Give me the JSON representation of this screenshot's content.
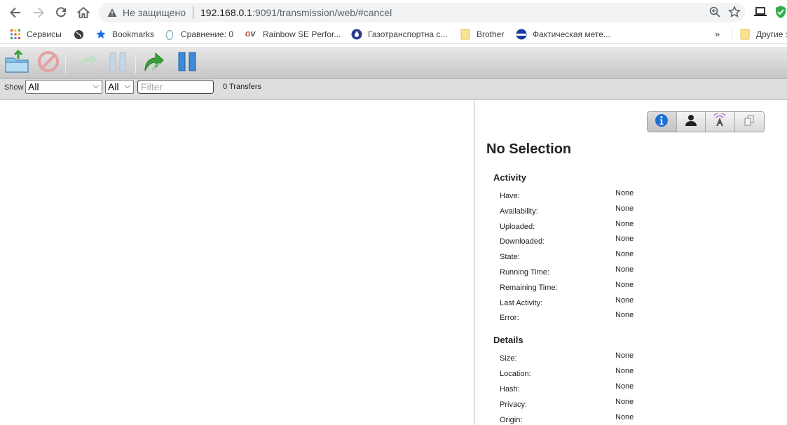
{
  "browser": {
    "omnibox": {
      "insecure_label": "Не защищено",
      "url_host": "192.168.0.1",
      "url_rest": ":9091/transmission/web/#cancel"
    },
    "bookmarks": [
      {
        "label": "Сервисы",
        "icon": "apps-grid-icon"
      },
      {
        "label": "",
        "icon": "globe-icon"
      },
      {
        "label": "Bookmarks",
        "icon": "star-icon"
      },
      {
        "label": "Сравнение: 0",
        "icon": "drop-icon"
      },
      {
        "label": "Rainbow SE Perfor...",
        "icon": "gv-logo-icon"
      },
      {
        "label": "Газотранспортна с...",
        "icon": "flame-icon"
      },
      {
        "label": "Brother",
        "icon": "folder-icon"
      },
      {
        "label": "Фактическая мете...",
        "icon": "weather-icon"
      }
    ],
    "overflow_label": "»",
    "other_bookmarks": "Другие з"
  },
  "toolbar": {
    "buttons": [
      "open-torrent",
      "remove-torrent",
      "resume-selected",
      "pause-selected",
      "resume-all",
      "pause-all"
    ]
  },
  "filterbar": {
    "show_label": "Show",
    "state_filter": "All",
    "tracker_filter": "All",
    "filter_placeholder": "Filter",
    "transfers_count": "0 Transfers"
  },
  "inspector": {
    "title": "No Selection",
    "activity": {
      "heading": "Activity",
      "rows": [
        {
          "label": "Have:",
          "value": "None"
        },
        {
          "label": "Availability:",
          "value": "None"
        },
        {
          "label": "Uploaded:",
          "value": "None"
        },
        {
          "label": "Downloaded:",
          "value": "None"
        },
        {
          "label": "State:",
          "value": "None"
        },
        {
          "label": "Running Time:",
          "value": "None"
        },
        {
          "label": "Remaining Time:",
          "value": "None"
        },
        {
          "label": "Last Activity:",
          "value": "None"
        },
        {
          "label": "Error:",
          "value": "None"
        }
      ]
    },
    "details": {
      "heading": "Details",
      "rows": [
        {
          "label": "Size:",
          "value": "None"
        },
        {
          "label": "Location:",
          "value": "None"
        },
        {
          "label": "Hash:",
          "value": "None"
        },
        {
          "label": "Privacy:",
          "value": "None"
        },
        {
          "label": "Origin:",
          "value": "None"
        }
      ]
    }
  }
}
